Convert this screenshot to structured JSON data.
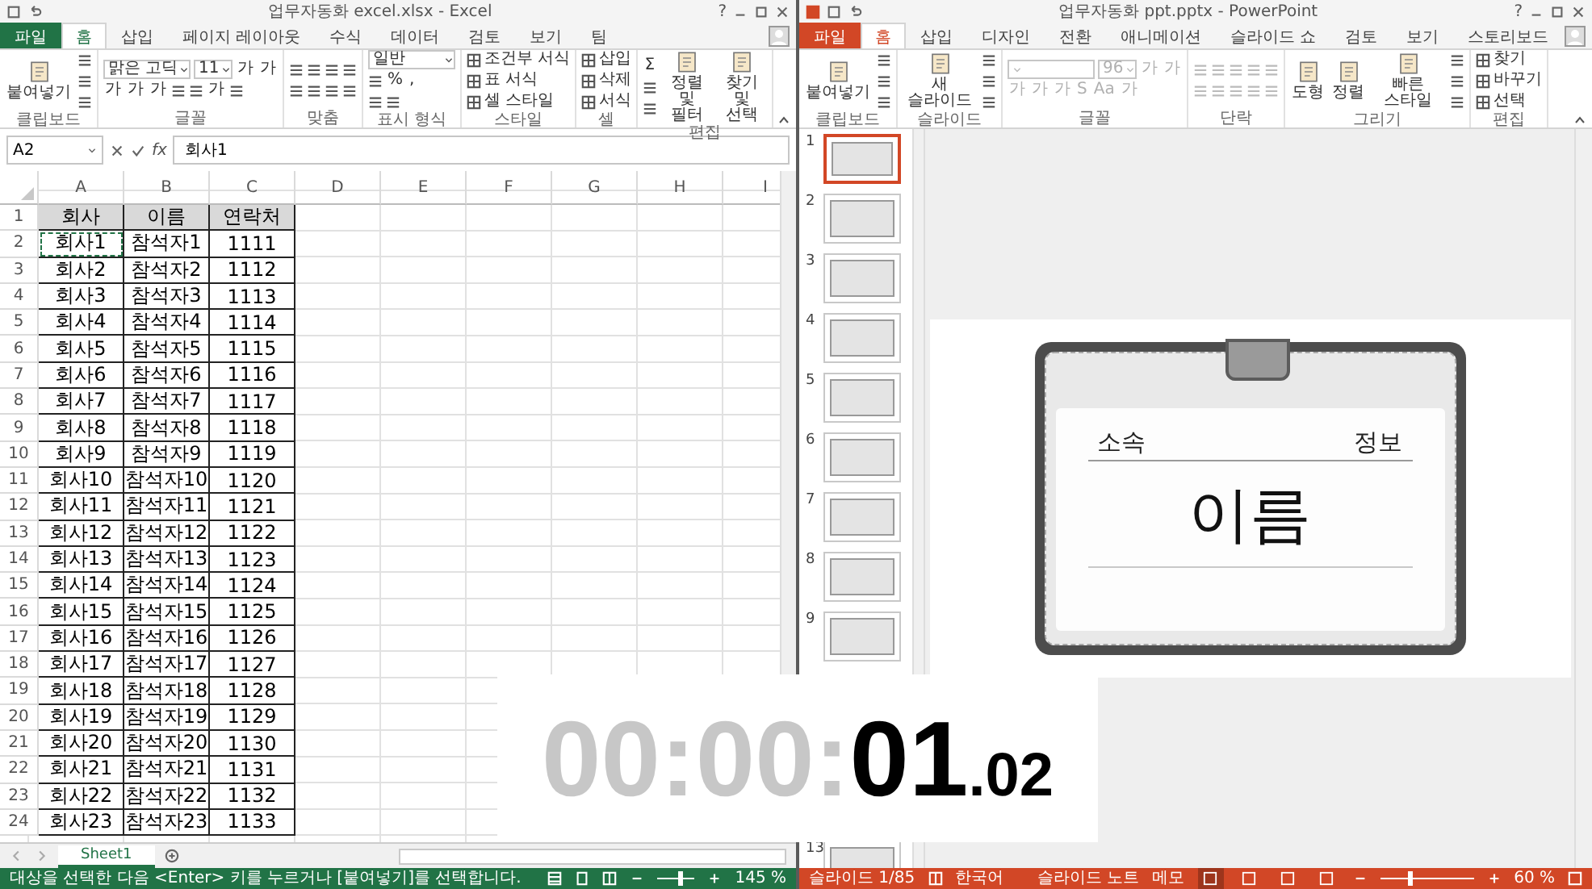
{
  "windows": [
    {
      "kind": "excel",
      "title": "업무자동화 excel.xlsx - Excel",
      "help": "?",
      "tabs": [
        {
          "kind": "file",
          "label": "파일",
          "selected": false
        },
        {
          "kind": "tab",
          "label": "홈",
          "selected": true
        },
        {
          "kind": "tab",
          "label": "삽입",
          "selected": false
        },
        {
          "kind": "tab",
          "label": "페이지 레이아웃",
          "selected": false
        },
        {
          "kind": "tab",
          "label": "수식",
          "selected": false
        },
        {
          "kind": "tab",
          "label": "데이터",
          "selected": false
        },
        {
          "kind": "tab",
          "label": "검토",
          "selected": false
        },
        {
          "kind": "tab",
          "label": "보기",
          "selected": false
        },
        {
          "kind": "tab",
          "label": "팀",
          "selected": false
        }
      ],
      "ribbon": [
        {
          "label": "클립보드",
          "disabled": false,
          "columns": [
            {
              "kind": "large",
              "text": "붙여넣기"
            },
            {
              "kind": "stack",
              "rows": [
                [
                  {
                    "kind": "icon"
                  }
                ],
                [
                  {
                    "kind": "icon"
                  }
                ],
                [
                  {
                    "kind": "icon"
                  }
                ]
              ]
            }
          ]
        },
        {
          "label": "글꼴",
          "disabled": false,
          "columns": [
            {
              "kind": "stack",
              "rows": [
                {
                  "items": [
                    {
                      "kind": "field",
                      "value": "맑은 고딕",
                      "wide": true
                    },
                    {
                      "kind": "field",
                      "value": "11",
                      "wide": false
                    },
                    {
                      "kind": "glyph",
                      "text": "가"
                    },
                    {
                      "kind": "glyph",
                      "text": "가"
                    }
                  ]
                },
                {
                  "items": [
                    {
                      "kind": "glyph",
                      "text": "가"
                    },
                    {
                      "kind": "glyph",
                      "text": "가"
                    },
                    {
                      "kind": "glyph",
                      "text": "가"
                    },
                    {
                      "kind": "icon"
                    },
                    {
                      "kind": "icon"
                    },
                    {
                      "kind": "glyph",
                      "text": "가"
                    },
                    {
                      "kind": "icon"
                    }
                  ]
                }
              ]
            }
          ]
        },
        {
          "label": "맞춤",
          "disabled": false,
          "columns": [
            {
              "kind": "stack",
              "rows": [
                [
                  {
                    "kind": "icon"
                  },
                  {
                    "kind": "icon"
                  },
                  {
                    "kind": "icon"
                  },
                  {
                    "kind": "icon"
                  }
                ],
                [
                  {
                    "kind": "icon"
                  },
                  {
                    "kind": "icon"
                  },
                  {
                    "kind": "icon"
                  },
                  {
                    "kind": "icon"
                  }
                ]
              ]
            }
          ]
        },
        {
          "label": "표시 형식",
          "disabled": false,
          "columns": [
            {
              "kind": "stack",
              "rows": [
                [
                  {
                    "kind": "field",
                    "value": "일반",
                    "wide": true
                  }
                ],
                [
                  {
                    "kind": "icon"
                  },
                  {
                    "kind": "glyph",
                    "text": "%"
                  },
                  {
                    "kind": "glyph",
                    "text": ","
                  }
                ],
                [
                  {
                    "kind": "icon"
                  },
                  {
                    "kind": "icon"
                  }
                ]
              ]
            }
          ]
        },
        {
          "label": "스타일",
          "disabled": false,
          "columns": [
            {
              "kind": "stack",
              "rows": [
                [
                  {
                    "kind": "small",
                    "text": "조건부 서식"
                  }
                ],
                [
                  {
                    "kind": "small",
                    "text": "표 서식"
                  }
                ],
                [
                  {
                    "kind": "small",
                    "text": "셀 스타일"
                  }
                ]
              ]
            }
          ]
        },
        {
          "label": "셀",
          "disabled": false,
          "columns": [
            {
              "kind": "stack",
              "rows": [
                [
                  {
                    "kind": "small",
                    "text": "삽입"
                  }
                ],
                [
                  {
                    "kind": "small",
                    "text": "삭제"
                  }
                ],
                [
                  {
                    "kind": "small",
                    "text": "서식"
                  }
                ]
              ]
            }
          ]
        },
        {
          "label": "편집",
          "disabled": false,
          "columns": [
            {
              "kind": "stack",
              "rows": [
                [
                  {
                    "kind": "glyph",
                    "text": "Σ"
                  }
                ],
                [
                  {
                    "kind": "icon"
                  }
                ],
                [
                  {
                    "kind": "icon"
                  }
                ]
              ]
            },
            {
              "kind": "large",
              "text": "정렬 및 필터"
            },
            {
              "kind": "large",
              "text": "찾기 및 선택"
            }
          ]
        }
      ],
      "formula_bar": {
        "name_box": "A2",
        "function_label": "fx",
        "value": "회사1"
      },
      "sheet": {
        "columns": [
          "A",
          "B",
          "C",
          "D",
          "E",
          "F",
          "G",
          "H",
          "I"
        ],
        "rows": [
          {
            "number": "1",
            "kind": "header",
            "cells": [
              {
                "text": "회사",
                "marquee": false
              },
              {
                "text": "이름",
                "marquee": false
              },
              {
                "text": "연락처",
                "marquee": false
              }
            ]
          },
          {
            "number": "2",
            "kind": "data",
            "cells": [
              {
                "text": "회사1",
                "marquee": true
              },
              {
                "text": "참석자1",
                "marquee": false
              },
              {
                "text": "1111",
                "marquee": false
              }
            ]
          },
          {
            "number": "3",
            "kind": "data",
            "cells": [
              {
                "text": "회사2",
                "marquee": false
              },
              {
                "text": "참석자2",
                "marquee": false
              },
              {
                "text": "1112",
                "marquee": false
              }
            ]
          },
          {
            "number": "4",
            "kind": "data",
            "cells": [
              {
                "text": "회사3",
                "marquee": false
              },
              {
                "text": "참석자3",
                "marquee": false
              },
              {
                "text": "1113",
                "marquee": false
              }
            ]
          },
          {
            "number": "5",
            "kind": "data",
            "cells": [
              {
                "text": "회사4",
                "marquee": false
              },
              {
                "text": "참석자4",
                "marquee": false
              },
              {
                "text": "1114",
                "marquee": false
              }
            ]
          },
          {
            "number": "6",
            "kind": "data",
            "cells": [
              {
                "text": "회사5",
                "marquee": false
              },
              {
                "text": "참석자5",
                "marquee": false
              },
              {
                "text": "1115",
                "marquee": false
              }
            ]
          },
          {
            "number": "7",
            "kind": "data",
            "cells": [
              {
                "text": "회사6",
                "marquee": false
              },
              {
                "text": "참석자6",
                "marquee": false
              },
              {
                "text": "1116",
                "marquee": false
              }
            ]
          },
          {
            "number": "8",
            "kind": "data",
            "cells": [
              {
                "text": "회사7",
                "marquee": false
              },
              {
                "text": "참석자7",
                "marquee": false
              },
              {
                "text": "1117",
                "marquee": false
              }
            ]
          },
          {
            "number": "9",
            "kind": "data",
            "cells": [
              {
                "text": "회사8",
                "marquee": false
              },
              {
                "text": "참석자8",
                "marquee": false
              },
              {
                "text": "1118",
                "marquee": false
              }
            ]
          },
          {
            "number": "10",
            "kind": "data",
            "cells": [
              {
                "text": "회사9",
                "marquee": false
              },
              {
                "text": "참석자9",
                "marquee": false
              },
              {
                "text": "1119",
                "marquee": false
              }
            ]
          },
          {
            "number": "11",
            "kind": "data",
            "cells": [
              {
                "text": "회사10",
                "marquee": false
              },
              {
                "text": "참석자10",
                "marquee": false
              },
              {
                "text": "1120",
                "marquee": false
              }
            ]
          },
          {
            "number": "12",
            "kind": "data",
            "cells": [
              {
                "text": "회사11",
                "marquee": false
              },
              {
                "text": "참석자11",
                "marquee": false
              },
              {
                "text": "1121",
                "marquee": false
              }
            ]
          },
          {
            "number": "13",
            "kind": "data",
            "cells": [
              {
                "text": "회사12",
                "marquee": false
              },
              {
                "text": "참석자12",
                "marquee": false
              },
              {
                "text": "1122",
                "marquee": false
              }
            ]
          },
          {
            "number": "14",
            "kind": "data",
            "cells": [
              {
                "text": "회사13",
                "marquee": false
              },
              {
                "text": "참석자13",
                "marquee": false
              },
              {
                "text": "1123",
                "marquee": false
              }
            ]
          },
          {
            "number": "15",
            "kind": "data",
            "cells": [
              {
                "text": "회사14",
                "marquee": false
              },
              {
                "text": "참석자14",
                "marquee": false
              },
              {
                "text": "1124",
                "marquee": false
              }
            ]
          },
          {
            "number": "16",
            "kind": "data",
            "cells": [
              {
                "text": "회사15",
                "marquee": false
              },
              {
                "text": "참석자15",
                "marquee": false
              },
              {
                "text": "1125",
                "marquee": false
              }
            ]
          },
          {
            "number": "17",
            "kind": "data",
            "cells": [
              {
                "text": "회사16",
                "marquee": false
              },
              {
                "text": "참석자16",
                "marquee": false
              },
              {
                "text": "1126",
                "marquee": false
              }
            ]
          },
          {
            "number": "18",
            "kind": "data",
            "cells": [
              {
                "text": "회사17",
                "marquee": false
              },
              {
                "text": "참석자17",
                "marquee": false
              },
              {
                "text": "1127",
                "marquee": false
              }
            ]
          },
          {
            "number": "19",
            "kind": "data",
            "cells": [
              {
                "text": "회사18",
                "marquee": false
              },
              {
                "text": "참석자18",
                "marquee": false
              },
              {
                "text": "1128",
                "marquee": false
              }
            ]
          },
          {
            "number": "20",
            "kind": "data",
            "cells": [
              {
                "text": "회사19",
                "marquee": false
              },
              {
                "text": "참석자19",
                "marquee": false
              },
              {
                "text": "1129",
                "marquee": false
              }
            ]
          },
          {
            "number": "21",
            "kind": "data",
            "cells": [
              {
                "text": "회사20",
                "marquee": false
              },
              {
                "text": "참석자20",
                "marquee": false
              },
              {
                "text": "1130",
                "marquee": false
              }
            ]
          },
          {
            "number": "22",
            "kind": "data",
            "cells": [
              {
                "text": "회사21",
                "marquee": false
              },
              {
                "text": "참석자21",
                "marquee": false
              },
              {
                "text": "1131",
                "marquee": false
              }
            ]
          },
          {
            "number": "23",
            "kind": "data",
            "cells": [
              {
                "text": "회사22",
                "marquee": false
              },
              {
                "text": "참석자22",
                "marquee": false
              },
              {
                "text": "1132",
                "marquee": false
              }
            ]
          },
          {
            "number": "24",
            "kind": "data",
            "cells": [
              {
                "text": "회사23",
                "marquee": false
              },
              {
                "text": "참석자23",
                "marquee": false
              },
              {
                "text": "1133",
                "marquee": false
              }
            ]
          }
        ]
      },
      "sheet_tabs": [
        {
          "label": "Sheet1",
          "selected": true
        }
      ],
      "status_bar": {
        "message": "대상을 선택한 다음 <Enter> 키를 누르거나 [붙여넣기]를 선택합니다.",
        "zoom": {
          "level": 0.59,
          "reading": "145 %"
        }
      }
    },
    {
      "kind": "powerpoint",
      "title": "업무자동화 ppt.pptx - PowerPoint",
      "help": "?",
      "tabs": [
        {
          "kind": "file",
          "label": "파일",
          "selected": false
        },
        {
          "kind": "tab",
          "label": "홈",
          "selected": true
        },
        {
          "kind": "tab",
          "label": "삽입",
          "selected": false
        },
        {
          "kind": "tab",
          "label": "디자인",
          "selected": false
        },
        {
          "kind": "tab",
          "label": "전환",
          "selected": false
        },
        {
          "kind": "tab",
          "label": "애니메이션",
          "selected": false
        },
        {
          "kind": "tab",
          "label": "슬라이드 쇼",
          "selected": false
        },
        {
          "kind": "tab",
          "label": "검토",
          "selected": false
        },
        {
          "kind": "tab",
          "label": "보기",
          "selected": false
        },
        {
          "kind": "tab",
          "label": "스토리보드",
          "selected": false
        }
      ],
      "ribbon": [
        {
          "label": "클립보드",
          "disabled": false,
          "columns": [
            {
              "kind": "large",
              "text": "붙여넣기"
            },
            {
              "kind": "stack",
              "rows": [
                [
                  {
                    "kind": "icon"
                  }
                ],
                [
                  {
                    "kind": "icon"
                  }
                ],
                [
                  {
                    "kind": "icon"
                  }
                ]
              ]
            }
          ]
        },
        {
          "label": "슬라이드",
          "disabled": false,
          "columns": [
            {
              "kind": "large",
              "text": "새 슬라이드"
            },
            {
              "kind": "stack",
              "rows": [
                [
                  {
                    "kind": "icon"
                  }
                ],
                [
                  {
                    "kind": "icon"
                  }
                ],
                [
                  {
                    "kind": "icon"
                  }
                ]
              ]
            }
          ]
        },
        {
          "label": "글꼴",
          "disabled": true,
          "columns": [
            {
              "kind": "stack",
              "rows": [
                {
                  "items": [
                    {
                      "kind": "field",
                      "wide": true
                    },
                    {
                      "kind": "field",
                      "value": "96",
                      "wide": false
                    },
                    {
                      "kind": "glyph",
                      "text": "가"
                    },
                    {
                      "kind": "glyph",
                      "text": "가"
                    }
                  ]
                },
                {
                  "items": [
                    {
                      "kind": "glyph",
                      "text": "가"
                    },
                    {
                      "kind": "glyph",
                      "text": "가"
                    },
                    {
                      "kind": "glyph",
                      "text": "가"
                    },
                    {
                      "kind": "glyph",
                      "text": "S"
                    },
                    {
                      "kind": "glyph",
                      "text": "Aa"
                    },
                    {
                      "kind": "glyph",
                      "text": "가"
                    }
                  ]
                }
              ]
            }
          ]
        },
        {
          "label": "단락",
          "disabled": true,
          "columns": [
            {
              "kind": "stack",
              "rows": [
                [
                  {
                    "kind": "icon"
                  },
                  {
                    "kind": "icon"
                  },
                  {
                    "kind": "icon"
                  },
                  {
                    "kind": "icon"
                  },
                  {
                    "kind": "icon"
                  }
                ],
                [
                  {
                    "kind": "icon"
                  },
                  {
                    "kind": "icon"
                  },
                  {
                    "kind": "icon"
                  },
                  {
                    "kind": "icon"
                  },
                  {
                    "kind": "icon"
                  }
                ]
              ]
            }
          ]
        },
        {
          "label": "그리기",
          "disabled": false,
          "columns": [
            {
              "kind": "large",
              "text": "도형"
            },
            {
              "kind": "large",
              "text": "정렬"
            },
            {
              "kind": "large",
              "text": "빠른 스타일"
            },
            {
              "kind": "stack",
              "rows": [
                [
                  {
                    "kind": "icon"
                  }
                ],
                [
                  {
                    "kind": "icon"
                  }
                ],
                [
                  {
                    "kind": "icon"
                  }
                ]
              ]
            }
          ]
        },
        {
          "label": "편집",
          "disabled": false,
          "columns": [
            {
              "kind": "stack",
              "rows": [
                [
                  {
                    "kind": "small",
                    "text": "찾기"
                  }
                ],
                [
                  {
                    "kind": "small",
                    "text": "바꾸기"
                  }
                ],
                [
                  {
                    "kind": "small",
                    "text": "선택"
                  }
                ]
              ]
            }
          ]
        }
      ],
      "slides": [
        {
          "number": "1",
          "selected": true
        },
        {
          "number": "2",
          "selected": false
        },
        {
          "number": "3",
          "selected": false
        },
        {
          "number": "4",
          "selected": false
        },
        {
          "number": "5",
          "selected": false
        },
        {
          "number": "6",
          "selected": false
        },
        {
          "number": "7",
          "selected": false
        },
        {
          "number": "8",
          "selected": false
        },
        {
          "number": "9",
          "selected": false
        },
        {
          "number": "13",
          "selected": false
        }
      ],
      "slide": {
        "affiliation": "소속",
        "info": "정보",
        "name": "이름"
      },
      "status_bar": {
        "slide_count": "슬라이드 1/85",
        "language": "한국어",
        "notes": "슬라이드 노트",
        "comments": "메모",
        "views": [
          {
            "selected": true
          },
          {
            "selected": false
          },
          {
            "selected": false
          },
          {
            "selected": false
          }
        ],
        "zoom": {
          "level": 0.31,
          "reading": "60 %"
        }
      }
    }
  ],
  "timer": {
    "dim": "00:00:",
    "main": "01",
    "fraction": ".02"
  }
}
